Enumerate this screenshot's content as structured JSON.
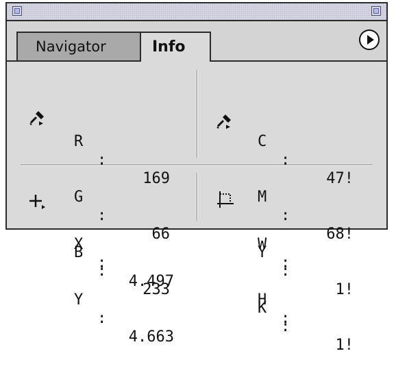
{
  "tabs": [
    {
      "label": "Navigator",
      "active": false
    },
    {
      "label": "Info",
      "active": true
    }
  ],
  "icons": {
    "eyedropper": "eyedropper-icon",
    "crosshair": "crosshair-icon",
    "selection": "selection-size-icon",
    "menu": "panel-menu-arrow-icon"
  },
  "rgb": [
    {
      "label": "R",
      "colon": ":",
      "value": "169"
    },
    {
      "label": "G",
      "colon": ":",
      "value": "66"
    },
    {
      "label": "B",
      "colon": ":",
      "value": "233"
    }
  ],
  "cmyk": [
    {
      "label": "C",
      "colon": ":",
      "value": "47!"
    },
    {
      "label": "M",
      "colon": ":",
      "value": "68!"
    },
    {
      "label": "Y",
      "colon": ":",
      "value": "1!"
    },
    {
      "label": "K",
      "colon": ":",
      "value": "1!"
    }
  ],
  "position": [
    {
      "label": "X",
      "colon": ":",
      "value": "4.497"
    },
    {
      "label": "Y",
      "colon": ":",
      "value": "4.663"
    }
  ],
  "size": [
    {
      "label": "W",
      "colon": ":",
      "value": ""
    },
    {
      "label": "H",
      "colon": ":",
      "value": ""
    }
  ]
}
